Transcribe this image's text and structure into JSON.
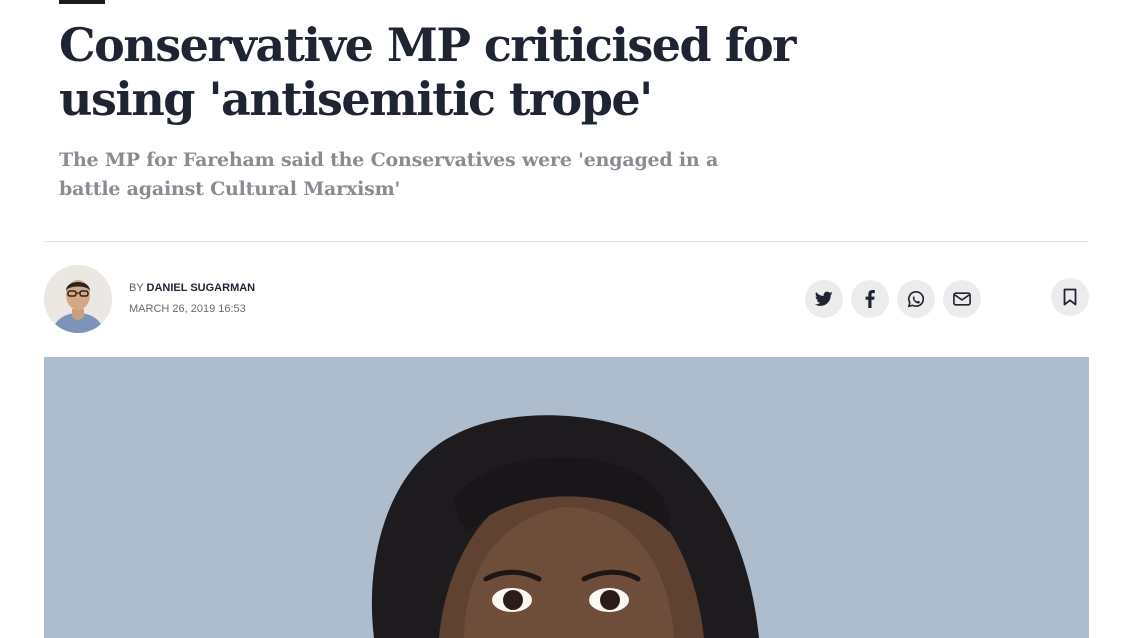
{
  "article": {
    "headline": "Conservative MP criticised for using 'antisemitic trope'",
    "standfirst": "The MP for Fareham said the Conservatives were 'engaged in a battle against Cultural Marxism'"
  },
  "byline": {
    "prefix": "BY",
    "author": "DANIEL SUGARMAN",
    "date": "MARCH 26, 2019 16:53"
  },
  "share": {
    "icons": [
      "twitter-icon",
      "facebook-icon",
      "whatsapp-icon",
      "email-icon"
    ],
    "bookmark_icon": "bookmark-icon"
  },
  "colors": {
    "headline": "#1f2433",
    "standfirst": "#8a8c93",
    "button_bg": "#ececec",
    "photo_backdrop": "#aebdce"
  }
}
